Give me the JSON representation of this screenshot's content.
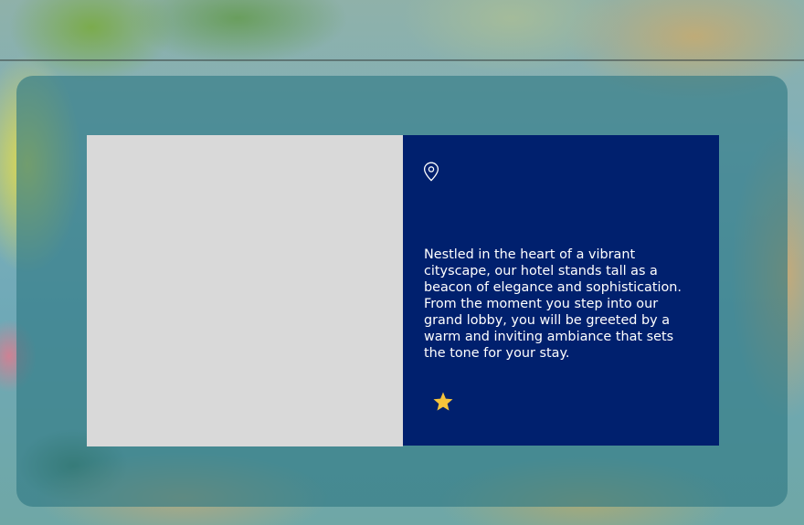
{
  "hotel": {
    "description": "Nestled in the heart of a vibrant cityscape, our hotel stands tall as a beacon of elegance and sophistication. From the moment you step into our grand lobby, you will be greeted by a warm and inviting ambiance that sets the tone for your stay.",
    "rating_stars": 1
  },
  "icons": {
    "location": "map-pin-icon",
    "rating": "star-icon"
  },
  "colors": {
    "panel_background": "#00206e",
    "star": "#f5c33b",
    "image_placeholder": "#d9d9d9",
    "text": "#ffffff"
  }
}
